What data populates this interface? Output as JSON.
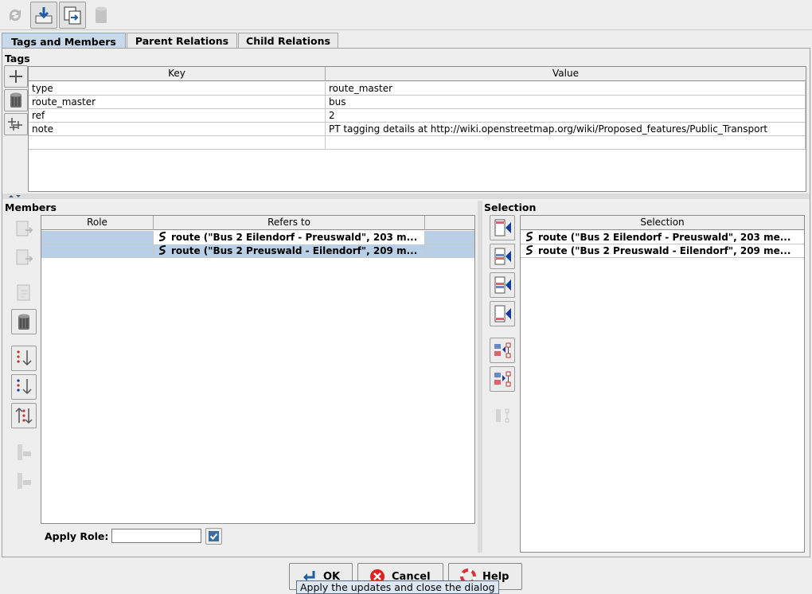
{
  "tabs": [
    {
      "label": "Tags and Members"
    },
    {
      "label": "Parent Relations"
    },
    {
      "label": "Child Relations"
    }
  ],
  "tags": {
    "title": "Tags",
    "col_key": "Key",
    "col_value": "Value",
    "rows": [
      {
        "key": "type",
        "value": "route_master"
      },
      {
        "key": "route_master",
        "value": "bus"
      },
      {
        "key": "ref",
        "value": "2"
      },
      {
        "key": "note",
        "value": "PT tagging details at http://wiki.openstreetmap.org/wiki/Proposed_features/Public_Transport"
      }
    ]
  },
  "members": {
    "title": "Members",
    "col_role": "Role",
    "col_refers": "Refers to",
    "rows": [
      {
        "role": "",
        "refers": "route (\"Bus 2 Eilendorf - Preuswald\", 203 m..."
      },
      {
        "role": "",
        "refers": "route (\"Bus 2 Preuswald - Eilendorf\", 209 m..."
      }
    ],
    "apply_role_label": "Apply Role:",
    "apply_role_value": ""
  },
  "selection": {
    "title": "Selection",
    "col": "Selection",
    "rows": [
      {
        "text": "route (\"Bus 2 Eilendorf - Preuswald\", 203 me..."
      },
      {
        "text": "route (\"Bus 2 Preuswald - Eilendorf\", 209 me..."
      }
    ]
  },
  "buttons": {
    "ok": "OK",
    "cancel": "Cancel",
    "help": "Help"
  },
  "tooltip": "Apply the updates and close the dialog",
  "colors": {
    "selected_row": "#b8cfe5",
    "active_tab": "#c9d9ec",
    "member_blue": "#1a3a9a",
    "member_red": "#c0392b"
  }
}
